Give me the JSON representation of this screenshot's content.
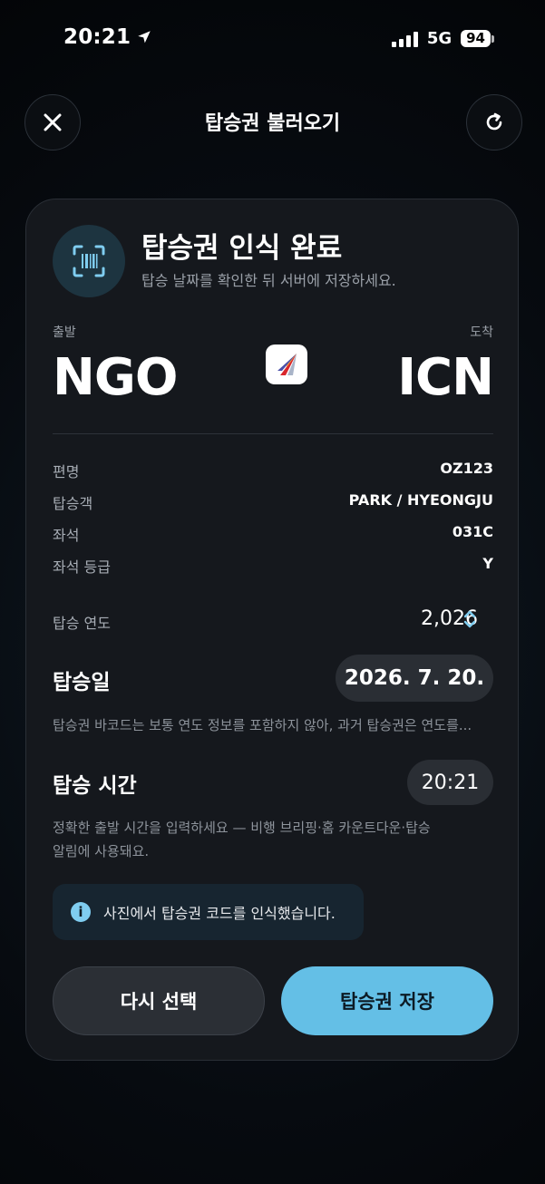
{
  "status_bar": {
    "time": "20:21",
    "network": "5G",
    "battery": "94"
  },
  "header": {
    "title": "탑승권 불러오기"
  },
  "card": {
    "title": "탑승권 인식 완료",
    "subtitle": "탑승 날짜를 확인한 뒤 서버에 저장하세요.",
    "departure_label": "출발",
    "arrival_label": "도착",
    "departure_code": "NGO",
    "arrival_code": "ICN"
  },
  "details": [
    {
      "label": "편명",
      "value": "OZ123"
    },
    {
      "label": "탑승객",
      "value": "PARK / HYEONGJU"
    },
    {
      "label": "좌석",
      "value": "031C"
    },
    {
      "label": "좌석 등급",
      "value": "Y"
    }
  ],
  "year": {
    "label": "탑승 연도",
    "value": "2,026"
  },
  "boarding_date": {
    "label": "탑승일",
    "value": "2026. 7. 20.",
    "note": "탑승권 바코드는 보통 연도 정보를 포함하지 않아, 과거 탑승권은 연도를..."
  },
  "boarding_time": {
    "label": "탑승 시간",
    "value": "20:21",
    "note_line1": "정확한 출발 시간을 입력하세요 — 비행 브리핑·홈 카운트다운·탑승",
    "note_line2": "알림에 사용돼요."
  },
  "info": {
    "text": "사진에서 탑승권 코드를 인식했습니다."
  },
  "buttons": {
    "retry": "다시 선택",
    "save": "탑승권 저장"
  },
  "colors": {
    "accent": "#64bfe6",
    "card_bg": "#15181d",
    "pill_bg": "#2a2e34"
  },
  "icons": {
    "close": "close-icon",
    "refresh": "refresh-icon",
    "scan": "barcode-scan-icon",
    "airline": "airline-logo",
    "info": "info-icon",
    "chevron": "chevron-updown-icon",
    "location": "location-arrow-icon"
  }
}
